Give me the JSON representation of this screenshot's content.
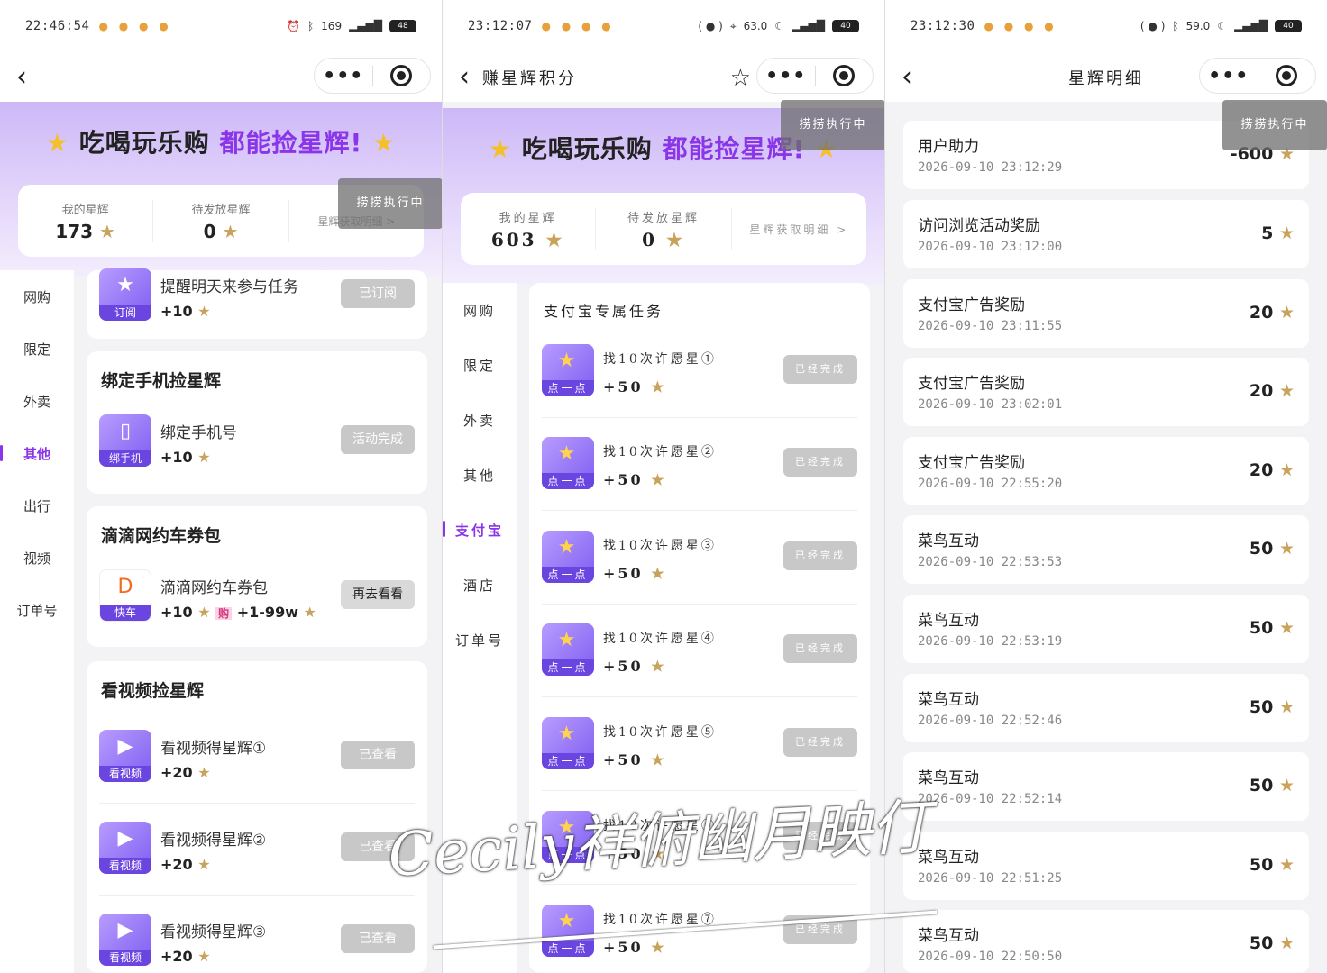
{
  "screens": [
    {
      "status_time": "22:46:54",
      "status_info": "169",
      "battery": "48",
      "nav_title": "",
      "banner": {
        "part1": "吃喝玩乐购",
        "part2": "都能捡星辉!"
      },
      "stats": {
        "my_label": "我的星辉",
        "my_value": "173",
        "pending_label": "待发放星辉",
        "pending_value": "0",
        "detail_link": "星辉获取明细 >"
      },
      "overlay": "捞捞执行中",
      "sidebar": [
        "网购",
        "限定",
        "外卖",
        "其他",
        "出行",
        "视频",
        "订单号"
      ],
      "active_sidebar": "其他",
      "cards": {
        "top_task": {
          "name": "提醒明天来参与任务",
          "icon_tag": "订阅",
          "reward": "+10",
          "button": "已订阅"
        },
        "bind": {
          "title": "绑定手机捡星辉",
          "name": "绑定手机号",
          "icon_tag": "绑手机",
          "reward": "+10",
          "button": "活动完成"
        },
        "didi": {
          "title": "滴滴网约车券包",
          "name": "滴滴网约车券包",
          "icon_tag": "快车",
          "reward": "+10",
          "extra_tag": "购",
          "extra": "+1-99w",
          "button": "再去看看"
        },
        "video": {
          "title": "看视频捡星辉",
          "tasks": [
            {
              "name": "看视频得星辉①",
              "icon_tag": "看视频",
              "reward": "+20",
              "button": "已查看"
            },
            {
              "name": "看视频得星辉②",
              "icon_tag": "看视频",
              "reward": "+20",
              "button": "已查看"
            },
            {
              "name": "看视频得星辉③",
              "icon_tag": "看视频",
              "reward": "+20",
              "button": "已查看"
            }
          ]
        }
      }
    },
    {
      "status_time": "23:12:07",
      "status_info": "63.0",
      "battery": "40",
      "nav_title": "赚星辉积分",
      "banner": {
        "part1": "吃喝玩乐购",
        "part2": "都能捡星辉!"
      },
      "stats": {
        "my_label": "我的星辉",
        "my_value": "603",
        "pending_label": "待发放星辉",
        "pending_value": "0",
        "detail_link": "星辉获取明细 >"
      },
      "overlay": "捞捞执行中",
      "sidebar": [
        "网购",
        "限定",
        "外卖",
        "其他",
        "支付宝",
        "酒店",
        "订单号"
      ],
      "active_sidebar": "支付宝",
      "section_title": "支付宝专属任务",
      "tasks": [
        {
          "name": "找10次许愿星①",
          "icon_tag": "点一点",
          "reward": "+50",
          "button": "已经完成"
        },
        {
          "name": "找10次许愿星②",
          "icon_tag": "点一点",
          "reward": "+50",
          "button": "已经完成"
        },
        {
          "name": "找10次许愿星③",
          "icon_tag": "点一点",
          "reward": "+50",
          "button": "已经完成"
        },
        {
          "name": "找10次许愿星④",
          "icon_tag": "点一点",
          "reward": "+50",
          "button": "已经完成"
        },
        {
          "name": "找10次许愿星⑤",
          "icon_tag": "点一点",
          "reward": "+50",
          "button": "已经完成"
        },
        {
          "name": "找10次许愿星⑥",
          "icon_tag": "点一点",
          "reward": "+50",
          "button": "已经完成"
        },
        {
          "name": "找10次许愿星⑦",
          "icon_tag": "点一点",
          "reward": "+50",
          "button": "已经完成"
        }
      ]
    },
    {
      "status_time": "23:12:30",
      "status_info": "59.0",
      "battery": "40",
      "nav_title": "星辉明细",
      "overlay": "捞捞执行中",
      "records": [
        {
          "name": "用户助力",
          "time": "2026-09-10 23:12:29",
          "amount": "-600"
        },
        {
          "name": "访问浏览活动奖励",
          "time": "2026-09-10 23:12:00",
          "amount": "5"
        },
        {
          "name": "支付宝广告奖励",
          "time": "2026-09-10 23:11:55",
          "amount": "20"
        },
        {
          "name": "支付宝广告奖励",
          "time": "2026-09-10 23:02:01",
          "amount": "20"
        },
        {
          "name": "支付宝广告奖励",
          "time": "2026-09-10 22:55:20",
          "amount": "20"
        },
        {
          "name": "菜鸟互动",
          "time": "2026-09-10 22:53:53",
          "amount": "50"
        },
        {
          "name": "菜鸟互动",
          "time": "2026-09-10 22:53:19",
          "amount": "50"
        },
        {
          "name": "菜鸟互动",
          "time": "2026-09-10 22:52:46",
          "amount": "50"
        },
        {
          "name": "菜鸟互动",
          "time": "2026-09-10 22:52:14",
          "amount": "50"
        },
        {
          "name": "菜鸟互动",
          "time": "2026-09-10 22:51:25",
          "amount": "50"
        },
        {
          "name": "菜鸟互动",
          "time": "2026-09-10 22:50:50",
          "amount": "50"
        }
      ]
    }
  ],
  "watermark": "Cecily祥俯幽月映仃",
  "colors": {
    "accent": "#8a35e8",
    "banner_top": "#cdb8f7",
    "star": "#c9a25c"
  }
}
